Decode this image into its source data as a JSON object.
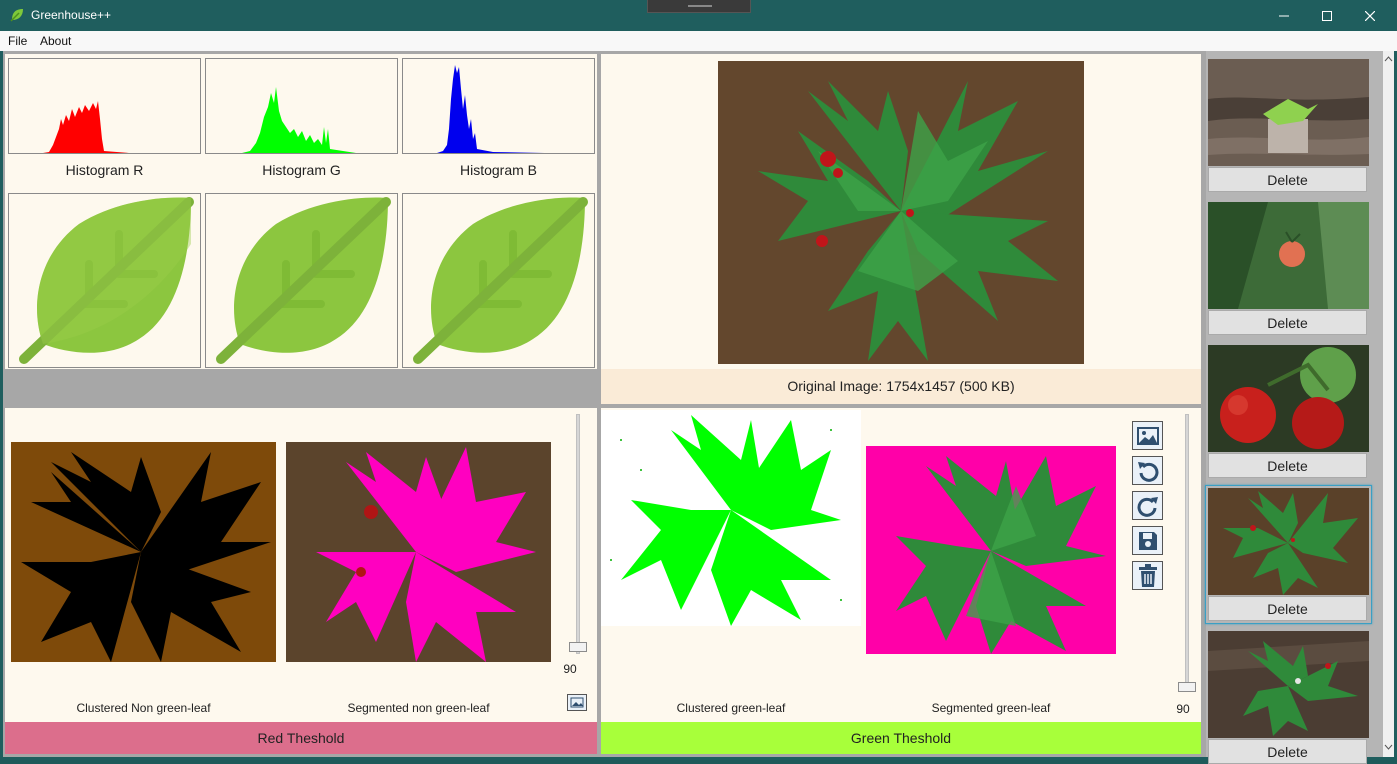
{
  "window": {
    "title": "Greenhouse++"
  },
  "menu": {
    "file": "File",
    "about": "About"
  },
  "histograms": [
    {
      "label": "Histogram R",
      "color": "#ff0000"
    },
    {
      "label": "Histogram G",
      "color": "#00ff00"
    },
    {
      "label": "Histogram B",
      "color": "#0000ff"
    }
  ],
  "original": {
    "caption": "Original Image: 1754x1457 (500 KB)"
  },
  "red_panel": {
    "left_caption": "Clustered Non green-leaf",
    "right_caption": "Segmented non green-leaf",
    "slider_value": "90",
    "footer": "Red Theshold",
    "footer_color": "#dc6e8c"
  },
  "green_panel": {
    "left_caption": "Clustered green-leaf",
    "right_caption": "Segmented green-leaf",
    "slider_value": "90",
    "footer": "Green Theshold",
    "footer_color": "#a8ff3a"
  },
  "toolbar": {
    "icons": [
      "image-icon",
      "rotate-left-icon",
      "rotate-right-icon",
      "save-icon",
      "trash-icon"
    ]
  },
  "strip": {
    "items": [
      {
        "delete_label": "Delete",
        "selected": false
      },
      {
        "delete_label": "Delete",
        "selected": false
      },
      {
        "delete_label": "Delete",
        "selected": false
      },
      {
        "delete_label": "Delete",
        "selected": true
      },
      {
        "delete_label": "Delete",
        "selected": false
      }
    ]
  }
}
